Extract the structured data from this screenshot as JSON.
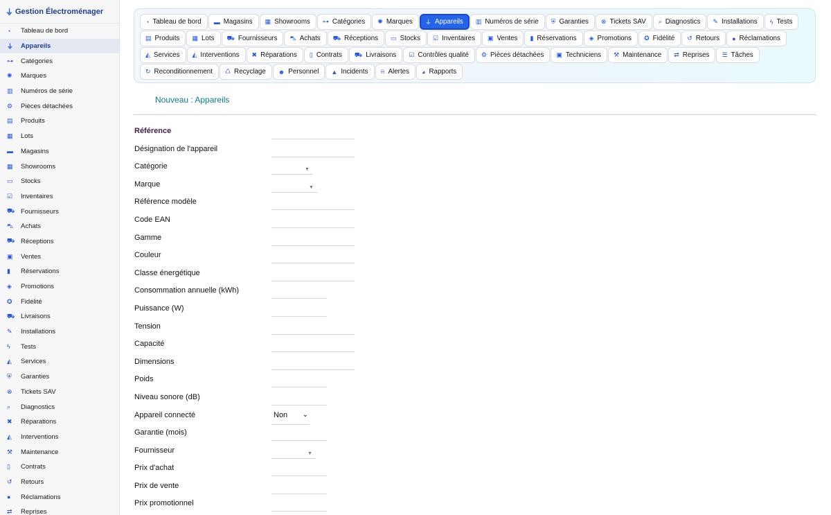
{
  "app": {
    "title": "Gestion Électroménager"
  },
  "sidebar": {
    "items": [
      {
        "label": "Tableau de bord",
        "icon": "gauge-icon",
        "glyph": "◔"
      },
      {
        "label": "Appareils",
        "icon": "plug-icon",
        "glyph": "⏚"
      },
      {
        "label": "Catégories",
        "icon": "sitemap-icon",
        "glyph": "⊶"
      },
      {
        "label": "Marques",
        "icon": "badge-icon",
        "glyph": "✺"
      },
      {
        "label": "Numéros de série",
        "icon": "barcode-icon",
        "glyph": "▥"
      },
      {
        "label": "Pièces détachées",
        "icon": "cog-icon",
        "glyph": "⚙"
      },
      {
        "label": "Produits",
        "icon": "box-icon",
        "glyph": "▤"
      },
      {
        "label": "Lots",
        "icon": "boxes-icon",
        "glyph": "▦"
      },
      {
        "label": "Magasins",
        "icon": "store-icon",
        "glyph": "▬"
      },
      {
        "label": "Showrooms",
        "icon": "grid-icon",
        "glyph": "▦"
      },
      {
        "label": "Stocks",
        "icon": "warehouse-icon",
        "glyph": "▭"
      },
      {
        "label": "Inventaires",
        "icon": "clipboard-check-icon",
        "glyph": "☑"
      },
      {
        "label": "Fournisseurs",
        "icon": "truck-icon",
        "glyph": "⛟"
      },
      {
        "label": "Achats",
        "icon": "dolly-icon",
        "glyph": "⛍"
      },
      {
        "label": "Réceptions",
        "icon": "truck-loading-icon",
        "glyph": "⛟"
      },
      {
        "label": "Ventes",
        "icon": "cash-register-icon",
        "glyph": "▣"
      },
      {
        "label": "Réservations",
        "icon": "bookmark-icon",
        "glyph": "▮"
      },
      {
        "label": "Promotions",
        "icon": "tags-icon",
        "glyph": "◈"
      },
      {
        "label": "Fidélité",
        "icon": "award-icon",
        "glyph": "✪"
      },
      {
        "label": "Livraisons",
        "icon": "shipping-icon",
        "glyph": "⛟"
      },
      {
        "label": "Installations",
        "icon": "wrench-icon",
        "glyph": "✎"
      },
      {
        "label": "Tests",
        "icon": "bolt-icon",
        "glyph": "ϟ"
      },
      {
        "label": "Services",
        "icon": "hand-holding-icon",
        "glyph": "◭"
      },
      {
        "label": "Garanties",
        "icon": "shield-icon",
        "glyph": "⛨"
      },
      {
        "label": "Tickets SAV",
        "icon": "lifebuoy-icon",
        "glyph": "⊗"
      },
      {
        "label": "Diagnostics",
        "icon": "search-icon",
        "glyph": "⌕"
      },
      {
        "label": "Réparations",
        "icon": "tools-icon",
        "glyph": "✖"
      },
      {
        "label": "Interventions",
        "icon": "hard-hat-icon",
        "glyph": "◭"
      },
      {
        "label": "Maintenance",
        "icon": "hammer-icon",
        "glyph": "⚒"
      },
      {
        "label": "Contrats",
        "icon": "file-contract-icon",
        "glyph": "▯"
      },
      {
        "label": "Retours",
        "icon": "undo-icon",
        "glyph": "↺"
      },
      {
        "label": "Réclamations",
        "icon": "comment-icon",
        "glyph": "●"
      },
      {
        "label": "Reprises",
        "icon": "exchange-icon",
        "glyph": "⇄"
      }
    ]
  },
  "tabs": [
    {
      "label": "Tableau de bord",
      "icon": "gauge-icon",
      "glyph": "◔"
    },
    {
      "label": "Magasins",
      "icon": "store-icon",
      "glyph": "▬"
    },
    {
      "label": "Showrooms",
      "icon": "grid-icon",
      "glyph": "▦"
    },
    {
      "label": "Catégories",
      "icon": "sitemap-icon",
      "glyph": "⊶"
    },
    {
      "label": "Marques",
      "icon": "badge-icon",
      "glyph": "✺"
    },
    {
      "label": "Appareils",
      "icon": "plug-icon",
      "glyph": "⏚",
      "active": true
    },
    {
      "label": "Numéros de série",
      "icon": "barcode-icon",
      "glyph": "▥"
    },
    {
      "label": "Garanties",
      "icon": "shield-icon",
      "glyph": "⛨"
    },
    {
      "label": "Tickets SAV",
      "icon": "lifebuoy-icon",
      "glyph": "⊗"
    },
    {
      "label": "Diagnostics",
      "icon": "search-icon",
      "glyph": "⌕"
    },
    {
      "label": "Installations",
      "icon": "wrench-icon",
      "glyph": "✎"
    },
    {
      "label": "Tests",
      "icon": "bolt-icon",
      "glyph": "ϟ"
    },
    {
      "label": "Produits",
      "icon": "box-icon",
      "glyph": "▤"
    },
    {
      "label": "Lots",
      "icon": "boxes-icon",
      "glyph": "▦"
    },
    {
      "label": "Fournisseurs",
      "icon": "truck-icon",
      "glyph": "⛟"
    },
    {
      "label": "Achats",
      "icon": "dolly-icon",
      "glyph": "⛍"
    },
    {
      "label": "Réceptions",
      "icon": "truck-loading-icon",
      "glyph": "⛟"
    },
    {
      "label": "Stocks",
      "icon": "warehouse-icon",
      "glyph": "▭"
    },
    {
      "label": "Inventaires",
      "icon": "clipboard-check-icon",
      "glyph": "☑"
    },
    {
      "label": "Ventes",
      "icon": "cash-register-icon",
      "glyph": "▣"
    },
    {
      "label": "Réservations",
      "icon": "bookmark-icon",
      "glyph": "▮"
    },
    {
      "label": "Promotions",
      "icon": "tags-icon",
      "glyph": "◈"
    },
    {
      "label": "Fidélité",
      "icon": "award-icon",
      "glyph": "✪"
    },
    {
      "label": "Retours",
      "icon": "undo-icon",
      "glyph": "↺"
    },
    {
      "label": "Réclamations",
      "icon": "comment-icon",
      "glyph": "●"
    },
    {
      "label": "Services",
      "icon": "hand-holding-icon",
      "glyph": "◭"
    },
    {
      "label": "Interventions",
      "icon": "hard-hat-icon",
      "glyph": "◭"
    },
    {
      "label": "Réparations",
      "icon": "tools-icon",
      "glyph": "✖"
    },
    {
      "label": "Contrats",
      "icon": "file-contract-icon",
      "glyph": "▯"
    },
    {
      "label": "Livraisons",
      "icon": "shipping-icon",
      "glyph": "⛟"
    },
    {
      "label": "Contrôles qualité",
      "icon": "clipboard-check-icon",
      "glyph": "☑"
    },
    {
      "label": "Pièces détachées",
      "icon": "cog-icon",
      "glyph": "⚙"
    },
    {
      "label": "Techniciens",
      "icon": "id-badge-icon",
      "glyph": "▣"
    },
    {
      "label": "Maintenance",
      "icon": "hammer-icon",
      "glyph": "⚒"
    },
    {
      "label": "Reprises",
      "icon": "exchange-icon",
      "glyph": "⇄"
    },
    {
      "label": "Tâches",
      "icon": "tasks-icon",
      "glyph": "☰"
    },
    {
      "label": "Reconditionnement",
      "icon": "redo-icon",
      "glyph": "↻"
    },
    {
      "label": "Recyclage",
      "icon": "recycle-icon",
      "glyph": "♺"
    },
    {
      "label": "Personnel",
      "icon": "users-icon",
      "glyph": "☻"
    },
    {
      "label": "Incidents",
      "icon": "warning-icon",
      "glyph": "▲"
    },
    {
      "label": "Alertes",
      "icon": "bell-icon",
      "glyph": "⍾"
    },
    {
      "label": "Rapports",
      "icon": "chart-pie-icon",
      "glyph": "◕"
    }
  ],
  "form": {
    "title": "Nouveau : Appareils",
    "fields": [
      {
        "label": "Référence",
        "type": "text",
        "width": "w120",
        "strong": true
      },
      {
        "label": "Désignation de l'appareil",
        "type": "text",
        "width": "w120"
      },
      {
        "label": "Catégorie",
        "type": "select",
        "selectWidth": 60
      },
      {
        "label": "Marque",
        "type": "select",
        "selectWidth": 66
      },
      {
        "label": "Référence modèle",
        "type": "text",
        "width": "w120"
      },
      {
        "label": "Code EAN",
        "type": "text",
        "width": "w120"
      },
      {
        "label": "Gamme",
        "type": "text",
        "width": "w120"
      },
      {
        "label": "Couleur",
        "type": "text",
        "width": "w120"
      },
      {
        "label": "Classe énergétique",
        "type": "text",
        "width": "w120"
      },
      {
        "label": "Consommation annuelle (kWh)",
        "type": "text",
        "width": "w80"
      },
      {
        "label": "Puissance (W)",
        "type": "text",
        "width": "w80"
      },
      {
        "label": "Tension",
        "type": "text",
        "width": "w120"
      },
      {
        "label": "Capacité",
        "type": "text",
        "width": "w120"
      },
      {
        "label": "Dimensions",
        "type": "text",
        "width": "w120"
      },
      {
        "label": "Poids",
        "type": "text",
        "width": "w80"
      },
      {
        "label": "Niveau sonore (dB)",
        "type": "text",
        "width": "w80"
      },
      {
        "label": "Appareil connecté",
        "type": "dropdown",
        "value": "Non"
      },
      {
        "label": "Garantie (mois)",
        "type": "text",
        "width": "w80"
      },
      {
        "label": "Fournisseur",
        "type": "select",
        "selectWidth": 64
      },
      {
        "label": "Prix d'achat",
        "type": "text",
        "width": "w80"
      },
      {
        "label": "Prix de vente",
        "type": "text",
        "width": "w80"
      },
      {
        "label": "Prix promotionnel",
        "type": "text",
        "width": "w80"
      }
    ]
  },
  "colors": {
    "accent": "#2563eb",
    "title": "#0f7a8c",
    "sidebar_bg": "#f7f7f8"
  }
}
